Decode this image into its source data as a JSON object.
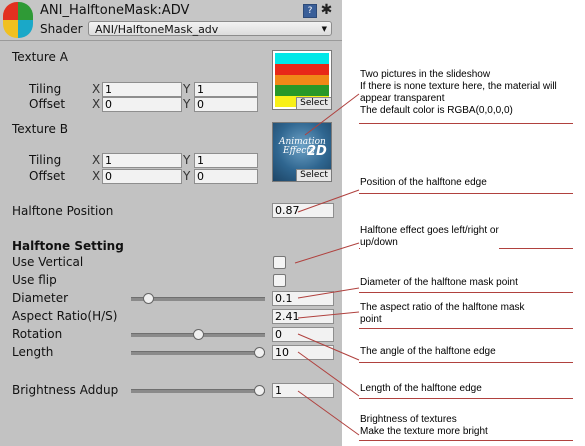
{
  "header": {
    "material_name": "ANI_HalftoneMask:ADV",
    "shader_label": "Shader",
    "shader_value": "ANI/HalftoneMask_adv",
    "help_icon": "?",
    "gear_icon": "✱"
  },
  "texture_a": {
    "label": "Texture A",
    "tiling_label": "Tiling",
    "offset_label": "Offset",
    "x": "X",
    "y": "Y",
    "tiling_x": "1",
    "tiling_y": "1",
    "offset_x": "0",
    "offset_y": "0",
    "select": "Select",
    "stripes": [
      "#00e8e8",
      "#e82818",
      "#f08818",
      "#289828",
      "#f8f018"
    ]
  },
  "texture_b": {
    "label": "Texture B",
    "tiling_label": "Tiling",
    "offset_label": "Offset",
    "x": "X",
    "y": "Y",
    "tiling_x": "1",
    "tiling_y": "1",
    "offset_x": "0",
    "offset_y": "0",
    "select": "Select",
    "logo_line1": "Animation",
    "logo_line2": "Effects",
    "logo_big": "2D"
  },
  "halftone_position": {
    "label": "Halftone Position",
    "value": "0.87"
  },
  "halftone_setting": {
    "heading": "Halftone Setting",
    "use_vertical": {
      "label": "Use Vertical",
      "checked": false
    },
    "use_flip": {
      "label": "Use flip",
      "checked": false
    },
    "diameter": {
      "label": "Diameter",
      "value": "0.1",
      "level": 0.1
    },
    "aspect_ratio": {
      "label": "Aspect Ratio(H/S)",
      "value": "2.41"
    },
    "rotation": {
      "label": "Rotation",
      "value": "0",
      "level": 0.5
    },
    "length": {
      "label": "Length",
      "value": "10",
      "level": 1.0
    }
  },
  "brightness_addup": {
    "label": "Brightness Addup",
    "value": "1",
    "level": 1.0
  },
  "annotations": {
    "textures": [
      "Two pictures in the slideshow",
      "If there is none texture here, the material will",
      "appear transparent",
      "The default color is RGBA(0,0,0,0)"
    ],
    "position": "Position of the halftone edge",
    "direction": [
      "Halftone effect goes left/right or",
      "up/down"
    ],
    "diameter": "Diameter of the halftone mask point",
    "aspect": [
      "The aspect ratio of the halftone mask",
      "point"
    ],
    "angle": "The angle of the halftone edge",
    "length": "Length of the halftone edge",
    "brightness": [
      "Brightness of textures",
      "Make the texture more bright"
    ]
  },
  "colors": {
    "annotation_line": "#b0413e",
    "panel": "#c2c2c2"
  }
}
